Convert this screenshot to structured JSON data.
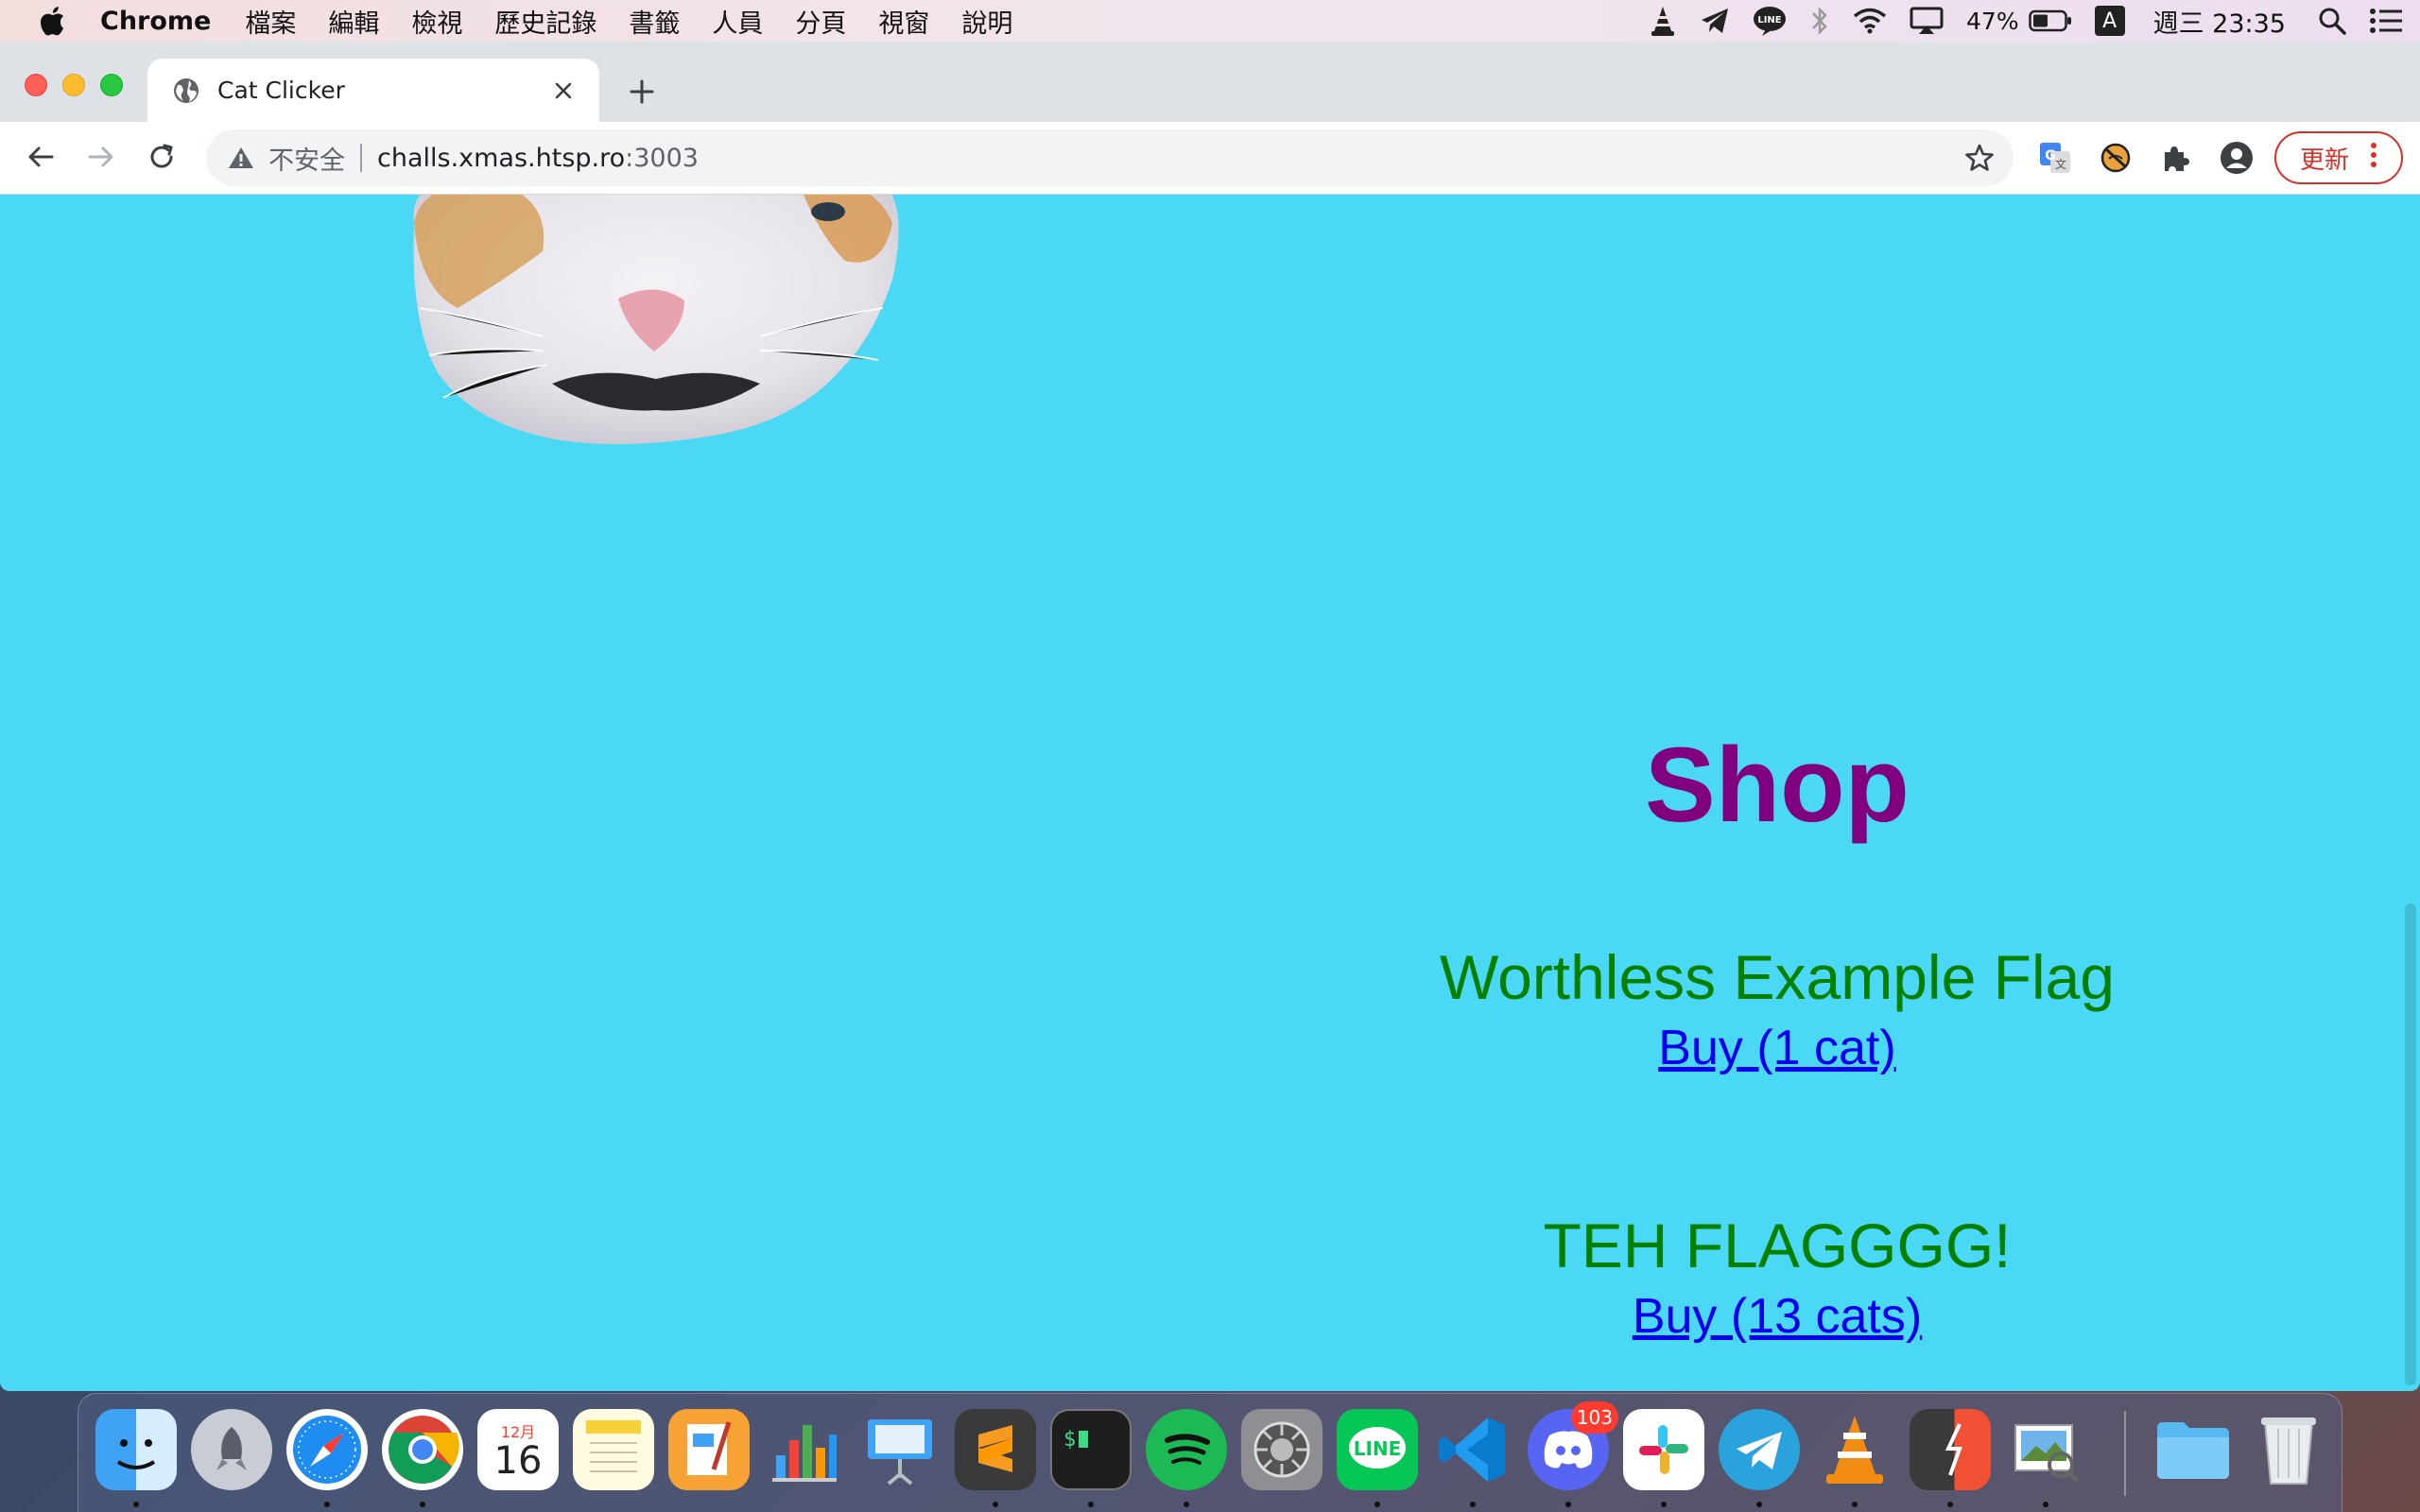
{
  "menubar": {
    "app": "Chrome",
    "items": [
      "檔案",
      "編輯",
      "檢視",
      "歷史記錄",
      "書籤",
      "人員",
      "分頁",
      "視窗",
      "說明"
    ],
    "battery": "47%",
    "input_method": "A",
    "clock": "週三 23:35"
  },
  "tab": {
    "title": "Cat Clicker"
  },
  "omnibox": {
    "security_label": "不安全",
    "host": "challs.xmas.htsp.ro",
    "port": ":3003"
  },
  "toolbar": {
    "update_label": "更新"
  },
  "page": {
    "shop_title": "Shop",
    "items": [
      {
        "name": "Worthless Example Flag",
        "buy": "Buy (1 cat)"
      },
      {
        "name": "TEH FLAGGGG!",
        "buy": "Buy (13 cats)"
      }
    ]
  },
  "dock": {
    "calendar_month": "12月",
    "calendar_day": "16",
    "discord_badge": "103",
    "apps": [
      "finder-icon",
      "launchpad-icon",
      "safari-icon",
      "chrome-icon",
      "calendar-icon",
      "notes-icon",
      "pages-icon",
      "numbers-icon",
      "keynote-icon",
      "sublime-text-icon",
      "terminal-icon",
      "spotify-icon",
      "system-preferences-icon",
      "line-icon",
      "vscode-icon",
      "discord-icon",
      "slack-icon",
      "telegram-icon",
      "vlc-icon",
      "git-client-icon",
      "preview-icon",
      "folder-icon",
      "trash-icon"
    ]
  },
  "colors": {
    "page_background": "#4ad8f5",
    "shop_title": "#800080",
    "item_name": "#008000",
    "link": "#0000ee"
  }
}
